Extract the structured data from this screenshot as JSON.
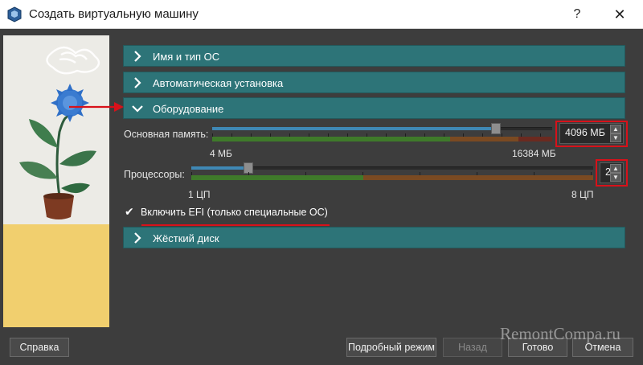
{
  "window": {
    "title": "Создать виртуальную машину",
    "help_glyph": "?",
    "close_glyph": "✕"
  },
  "sections": [
    {
      "label": "Имя и тип ОС",
      "expanded": false
    },
    {
      "label": "Автоматическая установка",
      "expanded": false
    },
    {
      "label": "Оборудование",
      "expanded": true
    },
    {
      "label": "Жёсткий диск",
      "expanded": false
    }
  ],
  "memory": {
    "label": "Основная память:",
    "value": "4096 МБ",
    "min_label": "4 МБ",
    "max_label": "16384 МБ",
    "min_mb": 4,
    "max_mb": 16384,
    "current_mb": 4096
  },
  "cpu": {
    "label": "Процессоры:",
    "value": "2",
    "min_label": "1 ЦП",
    "max_label": "8 ЦП",
    "min": 1,
    "max": 8,
    "current": 2
  },
  "efi": {
    "label": "Включить EFI (только специальные ОС)",
    "checked": true,
    "check_glyph": "✔"
  },
  "buttons": {
    "help": "Справка",
    "expert": "Подробный режим",
    "back": "Назад",
    "finish": "Готово",
    "cancel": "Отмена"
  },
  "watermark": "RemontCompa.ru",
  "colors": {
    "section_bg": "#2d7478",
    "highlight": "#d8111a",
    "slider_fill": "#3f88b5"
  }
}
